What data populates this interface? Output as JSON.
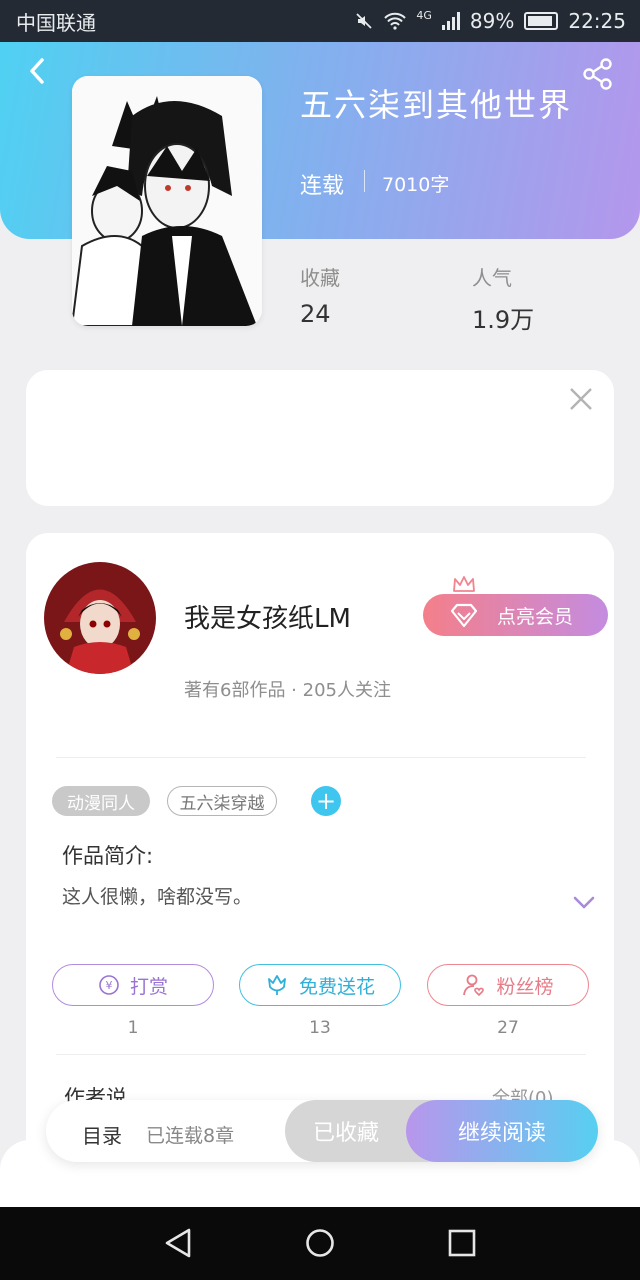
{
  "status_bar": {
    "carrier": "中国联通",
    "network": "4G",
    "battery": "89%",
    "time": "22:25"
  },
  "book": {
    "title": "五六柒到其他世界",
    "status": "连载",
    "word_count": "7010字",
    "favorites_label": "收藏",
    "favorites_value": "24",
    "popularity_label": "人气",
    "popularity_value": "1.9万"
  },
  "author": {
    "name": "我是女孩纸LM",
    "meta": "著有6部作品 · 205人关注",
    "vip_button": "点亮会员"
  },
  "tags": [
    "动漫同人",
    "五六柒穿越"
  ],
  "intro": {
    "title": "作品简介:",
    "text": "这人很懒，啥都没写。"
  },
  "actions": {
    "tip": {
      "label": "打赏",
      "count": "1"
    },
    "flower": {
      "label": "免费送花",
      "count": "13"
    },
    "fans": {
      "label": "粉丝榜",
      "count": "27"
    }
  },
  "author_says": {
    "title": "作者说",
    "all_link": "全部(0)"
  },
  "bottom_bar": {
    "toc": "目录",
    "chapters": "已连载8章",
    "collected": "已收藏",
    "continue": "继续阅读"
  },
  "colors": {
    "header_gradient_start": "#4fd1f2",
    "header_gradient_end": "#b497ec",
    "tag_add": "#3fc6ef",
    "vip_gradient_start": "#f47f8a",
    "vip_gradient_end": "#c48ce0"
  }
}
